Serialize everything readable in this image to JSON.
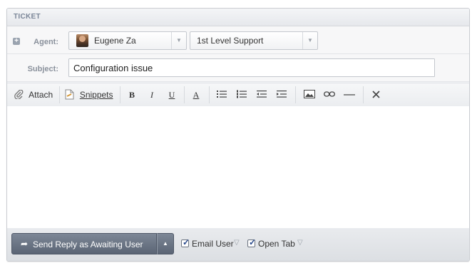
{
  "panel": {
    "title": "TICKET"
  },
  "agent": {
    "label": "Agent:",
    "expand_icon": "plus-square-icon",
    "name": "Eugene Za",
    "team": "1st Level Support"
  },
  "subject": {
    "label": "Subject:",
    "value": "Configuration issue"
  },
  "toolbar": {
    "attach": "Attach",
    "snippets": "Snippets",
    "bold": "B",
    "italic": "I",
    "underline": "U",
    "font_color": "A"
  },
  "footer": {
    "send_label": "Send Reply as Awaiting User",
    "email_user_label": "Email User",
    "email_user_checked": true,
    "open_tab_label": "Open Tab",
    "open_tab_checked": true
  },
  "colors": {
    "send_button": "#5b6575",
    "header_text": "#7b8698"
  }
}
